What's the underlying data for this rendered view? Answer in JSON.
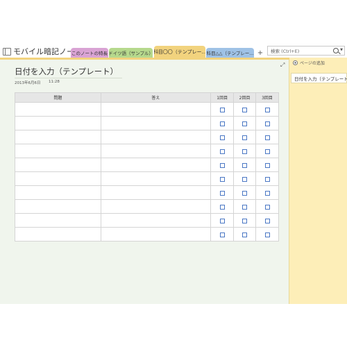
{
  "notebook": {
    "title": "モバイル暗記ノート"
  },
  "tabs": [
    {
      "label": "このノートの特長",
      "color": "#d9a3d4"
    },
    {
      "label": "ドイツ語（サンプル）",
      "color": "#b6d98d"
    },
    {
      "label": "科目〇〇（テンプレー...",
      "color": "#f2d37e",
      "selected": true
    },
    {
      "label": "科目△△（テンプレー...",
      "color": "#9fc2e6"
    }
  ],
  "add_tab_label": "+",
  "search": {
    "placeholder": "検索 (Ctrl+E)"
  },
  "page": {
    "title": "日付を入力（テンプレート）",
    "date": "2013年6月6日",
    "time": "11:28"
  },
  "table": {
    "headers": [
      "問題",
      "答え",
      "1回目",
      "2回目",
      "3回目"
    ],
    "row_count": 10
  },
  "sidebar": {
    "add_page_label": "ページの追加",
    "pages": [
      "日付を入力（テンプレート）"
    ]
  },
  "colors": {
    "page_background": "#f0f5ed",
    "section_accent": "#f2d37e",
    "page_list_background": "#fdeeb8"
  }
}
